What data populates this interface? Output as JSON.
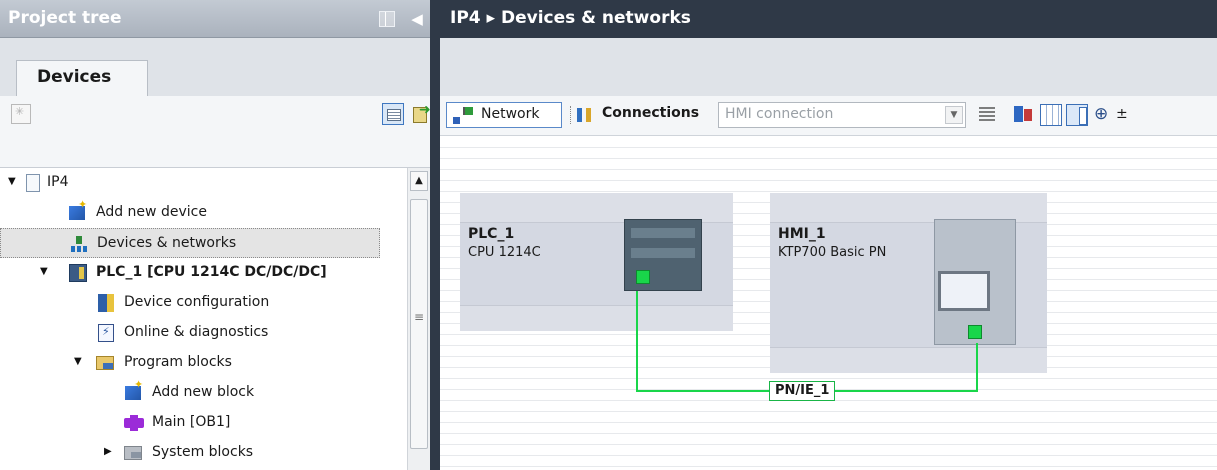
{
  "project_tree": {
    "title": "Project tree",
    "tab_label": "Devices",
    "items": [
      {
        "label": "IP4",
        "expanded": true,
        "icon": "page-icon"
      },
      {
        "label": "Add new device",
        "icon": "add-device-icon"
      },
      {
        "label": "Devices & networks",
        "icon": "network-icon",
        "selected": true
      },
      {
        "label": "PLC_1 [CPU 1214C DC/DC/DC]",
        "expanded": true,
        "icon": "plc-icon"
      },
      {
        "label": "Device configuration",
        "icon": "device-config-icon"
      },
      {
        "label": "Online & diagnostics",
        "icon": "diagnostics-icon"
      },
      {
        "label": "Program blocks",
        "expanded": true,
        "icon": "folder-icon"
      },
      {
        "label": "Add new block",
        "icon": "add-block-icon"
      },
      {
        "label": "Main [OB1]",
        "icon": "ob-block-icon"
      },
      {
        "label": "System blocks",
        "expanded": false,
        "icon": "system-folder-icon"
      }
    ]
  },
  "editor": {
    "breadcrumb": "IP4 ▸ Devices & networks",
    "toolbar": {
      "network_label": "Network",
      "connections_label": "Connections",
      "connection_type_value": "HMI connection"
    }
  },
  "network_view": {
    "devices": [
      {
        "name": "PLC_1",
        "type": "CPU 1214C"
      },
      {
        "name": "HMI_1",
        "type": "KTP700 Basic PN"
      }
    ],
    "subnet_label": "PN/IE_1",
    "subnet_color": "#19d64a"
  },
  "colors": {
    "header_dark": "#2f3947",
    "header_light": "#aab2bd",
    "device_fill": "#d4d8e2",
    "port_green": "#19d64a"
  }
}
